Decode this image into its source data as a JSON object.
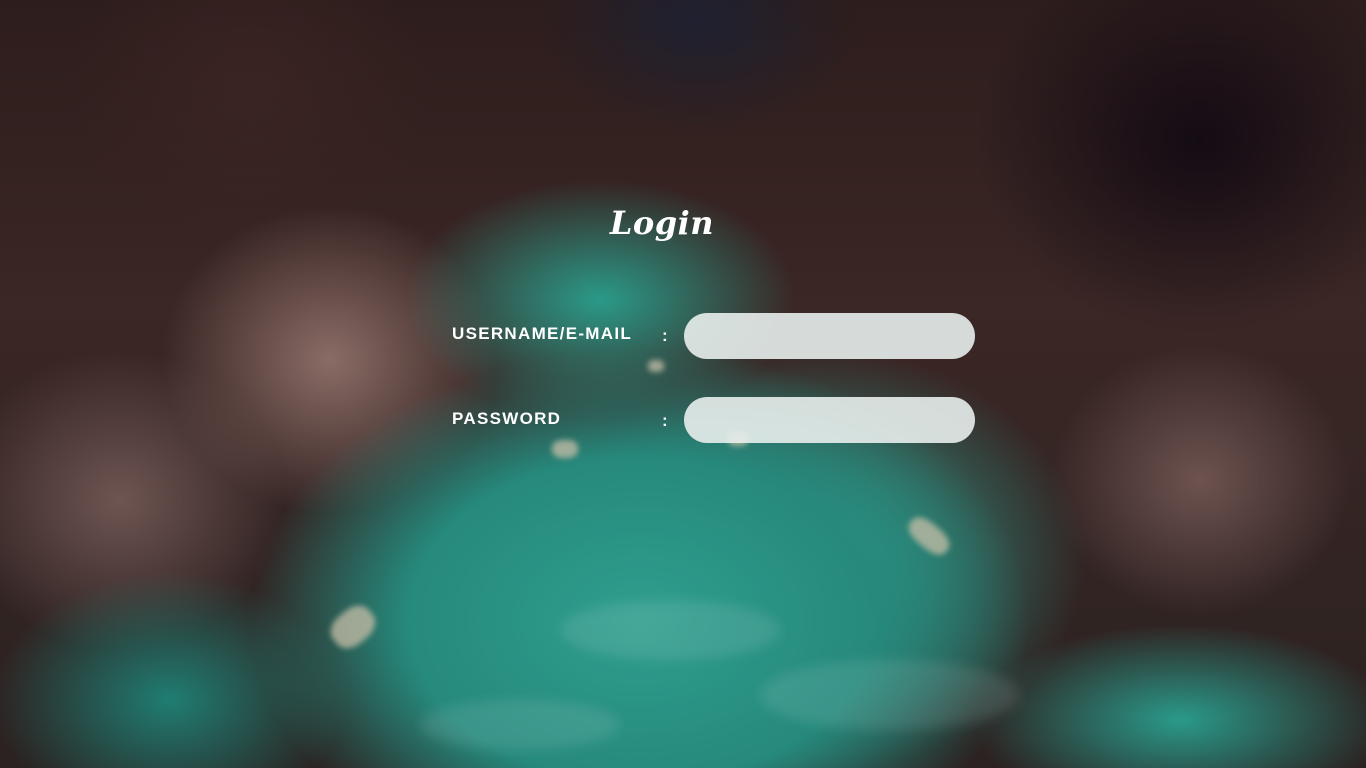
{
  "page": {
    "title": "Login"
  },
  "form": {
    "username": {
      "label": "USERNAME/E-MAIL",
      "separator": ":",
      "value": "",
      "placeholder": ""
    },
    "password": {
      "label": "PASSWORD",
      "separator": ":",
      "value": "",
      "placeholder": ""
    }
  },
  "theme": {
    "text_color": "#ffffff",
    "field_background": "#e8eeec",
    "water_color": "#2a9a88",
    "rock_color": "#3b2725"
  },
  "background": {
    "icon": "blurred-river-canyon-photo"
  }
}
